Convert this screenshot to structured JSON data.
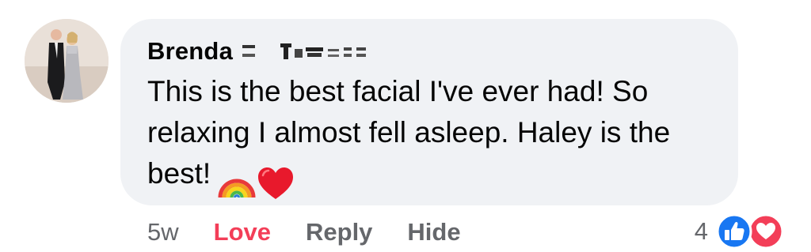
{
  "comment": {
    "author_first": "Brenda",
    "text": "This is the best facial I've ever had! So relaxing I almost fell asleep. Haley is the best!",
    "emojis": [
      "rainbow-icon",
      "red-heart-icon"
    ],
    "timestamp": "5w",
    "actions": {
      "love": "Love",
      "reply": "Reply",
      "hide": "Hide"
    },
    "reaction_count": "4",
    "reaction_icons": [
      "like-icon",
      "love-icon"
    ]
  },
  "colors": {
    "bubble": "#f0f2f5",
    "love": "#f33e58",
    "muted": "#65676b",
    "like": "#1877f2"
  }
}
